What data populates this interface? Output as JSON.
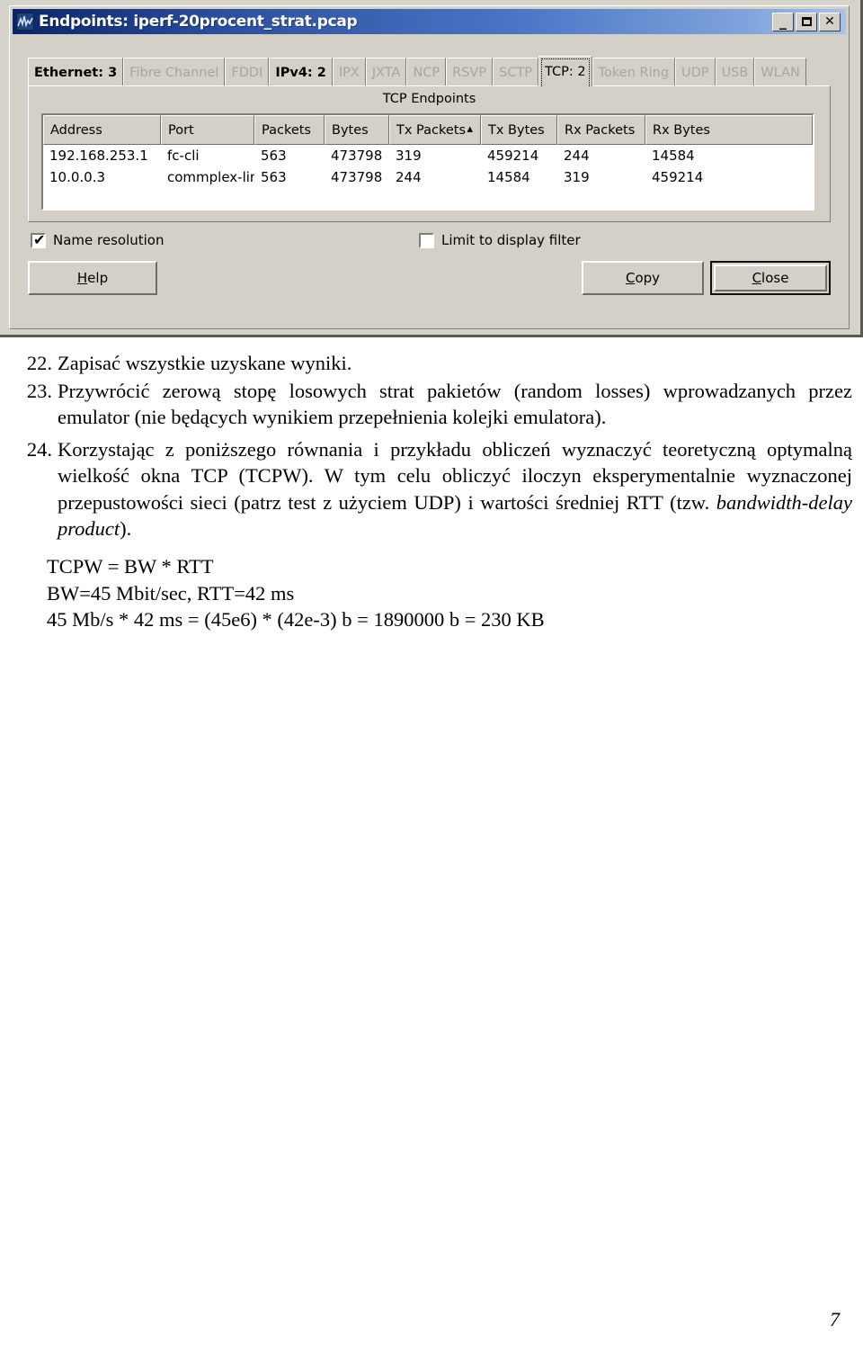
{
  "window": {
    "title": "Endpoints: iperf-20procent_strat.pcap",
    "icon": "wireshark-icon",
    "controls": {
      "minimize": "minimize-icon",
      "maximize": "maximize-icon",
      "close": "close-icon"
    },
    "titlebar_color": "#2b4f9e",
    "face_color": "#d4d0c8"
  },
  "tabs": [
    {
      "label": "Ethernet: 3",
      "enabled": true,
      "selected": false
    },
    {
      "label": "Fibre Channel",
      "enabled": false,
      "selected": false
    },
    {
      "label": "FDDI",
      "enabled": false,
      "selected": false
    },
    {
      "label": "IPv4: 2",
      "enabled": true,
      "selected": false
    },
    {
      "label": "IPX",
      "enabled": false,
      "selected": false
    },
    {
      "label": "JXTA",
      "enabled": false,
      "selected": false
    },
    {
      "label": "NCP",
      "enabled": false,
      "selected": false
    },
    {
      "label": "RSVP",
      "enabled": false,
      "selected": false
    },
    {
      "label": "SCTP",
      "enabled": false,
      "selected": false
    },
    {
      "label": "TCP: 2",
      "enabled": true,
      "selected": true
    },
    {
      "label": "Token Ring",
      "enabled": false,
      "selected": false
    },
    {
      "label": "UDP",
      "enabled": false,
      "selected": false
    },
    {
      "label": "USB",
      "enabled": false,
      "selected": false
    },
    {
      "label": "WLAN",
      "enabled": false,
      "selected": false
    }
  ],
  "page": {
    "caption": "TCP Endpoints",
    "columns": [
      {
        "label": "Address",
        "sorted": false
      },
      {
        "label": "Port",
        "sorted": false
      },
      {
        "label": "Packets",
        "sorted": false
      },
      {
        "label": "Bytes",
        "sorted": false
      },
      {
        "label": "Tx Packets",
        "sorted": true,
        "sort_mark": "▴"
      },
      {
        "label": "Tx Bytes",
        "sorted": false
      },
      {
        "label": "Rx Packets",
        "sorted": false
      },
      {
        "label": "Rx Bytes",
        "sorted": false
      }
    ],
    "rows": [
      {
        "address": "192.168.253.1",
        "port": "fc-cli",
        "packets": "563",
        "bytes": "473798",
        "tx_packets": "319",
        "tx_bytes": "459214",
        "rx_packets": "244",
        "rx_bytes": "14584"
      },
      {
        "address": "10.0.0.3",
        "port": "commplex-link",
        "packets": "563",
        "bytes": "473798",
        "tx_packets": "244",
        "tx_bytes": "14584",
        "rx_packets": "319",
        "rx_bytes": "459214"
      }
    ]
  },
  "options": {
    "name_resolution": {
      "label": "Name resolution",
      "checked": true,
      "tick": "✔"
    },
    "limit_to_display_filter": {
      "label": "Limit to display filter",
      "checked": false,
      "tick": ""
    }
  },
  "buttons": {
    "help": {
      "accel": "H",
      "rest": "elp",
      "default": false
    },
    "copy": {
      "accel": "C",
      "rest": "opy",
      "default": false
    },
    "close": {
      "accel": "C",
      "rest": "lose",
      "default": true
    }
  },
  "document": {
    "items": [
      {
        "number": "22.",
        "text": "Zapisać wszystkie uzyskane wyniki."
      },
      {
        "number": "23.",
        "text": "Przywrócić zerową stopę losowych strat pakietów (random losses) wprowadzanych przez emulator (nie będących wynikiem przepełnienia kolejki emulatora)."
      }
    ],
    "item24": {
      "number": "24.",
      "part1": "Korzystając z poniższego równania i przykładu obliczeń wyznaczyć teoretyczną optymalną wielkość okna TCP (TCPW). W tym celu obliczyć iloczyn eksperymentalnie wyznaczonej przepustowości sieci (patrz test z użyciem UDP) i wartości średniej RTT (tzw. ",
      "italic": "bandwidth-delay product",
      "part2": ")."
    },
    "formula": [
      "TCPW = BW * RTT",
      "BW=45 Mbit/sec, RTT=42 ms",
      "45 Mb/s * 42 ms = (45e6) * (42e-3) b = 1890000 b = 230 KB"
    ],
    "page_number": "7"
  }
}
